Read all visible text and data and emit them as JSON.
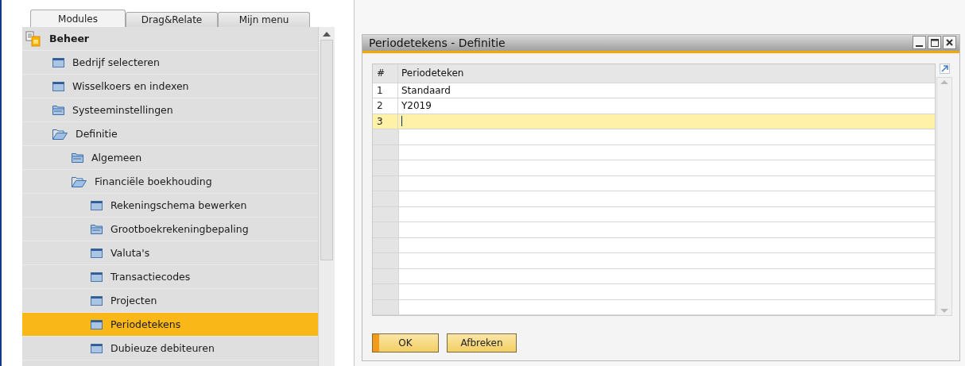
{
  "tabs": [
    {
      "label": "Modules",
      "selected": true
    },
    {
      "label": "Drag&Relate",
      "selected": false
    },
    {
      "label": "Mijn menu",
      "selected": false
    }
  ],
  "tree": {
    "label": "Beheer",
    "kind": "module",
    "selected": false,
    "children": [
      {
        "label": "Bedrijf selecteren",
        "kind": "window",
        "selected": false
      },
      {
        "label": "Wisselkoers en indexen",
        "kind": "window",
        "selected": false
      },
      {
        "label": "Systeeminstellingen",
        "kind": "folder",
        "expanded": false,
        "selected": false
      },
      {
        "label": "Definitie",
        "kind": "folder",
        "expanded": true,
        "selected": false,
        "children": [
          {
            "label": "Algemeen",
            "kind": "folder",
            "expanded": false,
            "selected": false
          },
          {
            "label": "Financiële boekhouding",
            "kind": "folder",
            "expanded": true,
            "selected": false,
            "children": [
              {
                "label": "Rekeningschema bewerken",
                "kind": "window",
                "selected": false
              },
              {
                "label": "Grootboekrekeningbepaling",
                "kind": "folder",
                "expanded": false,
                "selected": false
              },
              {
                "label": "Valuta's",
                "kind": "window",
                "selected": false
              },
              {
                "label": "Transactiecodes",
                "kind": "window",
                "selected": false
              },
              {
                "label": "Projecten",
                "kind": "window",
                "selected": false
              },
              {
                "label": "Periodetekens",
                "kind": "window",
                "selected": true
              },
              {
                "label": "Dubieuze debiteuren",
                "kind": "window",
                "selected": false
              }
            ]
          }
        ]
      }
    ]
  },
  "dialog": {
    "title": "Periodetekens - Definitie",
    "table": {
      "columns": [
        "#",
        "Periodeteken"
      ],
      "rows": [
        {
          "number": "1",
          "value": "Standaard",
          "selected": false
        },
        {
          "number": "2",
          "value": "Y2019",
          "selected": false
        },
        {
          "number": "3",
          "value": "",
          "selected": true
        }
      ]
    },
    "buttons": [
      {
        "label": "OK",
        "default": true
      },
      {
        "label": "Afbreken",
        "default": false
      }
    ]
  }
}
